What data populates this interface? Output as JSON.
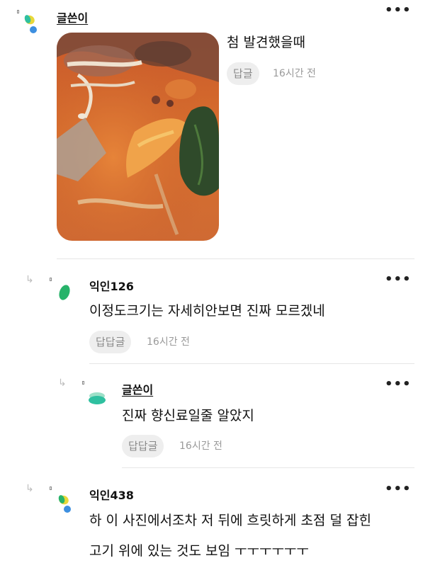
{
  "comments": [
    {
      "author": "글쓴이",
      "text": "첨 발견했을때",
      "reply_label": "답글",
      "time": "16시간 전"
    },
    {
      "author": "익인126",
      "text": "이정도크기는 자세히안보면 진짜 모르겠네",
      "reply_label": "답답글",
      "time": "16시간 전"
    },
    {
      "author": "글쓴이",
      "text": "진짜 향신료일줄 알았지",
      "reply_label": "답답글",
      "time": "16시간 전"
    },
    {
      "author": "익인438",
      "text_line1": "하 이 사진에서조차 저 뒤에 흐릿하게 초점 덜 잡힌",
      "text_line2": "고기 위에 있는 것도 보임 ㅜㅜㅜㅜㅜㅜ"
    }
  ],
  "more_label": "•••",
  "icons": {
    "avatar_colors": {
      "blue": "#3d8fe0",
      "yellow": "#e8d83a",
      "green": "#27b36a",
      "teal": "#2fc0a0"
    }
  }
}
